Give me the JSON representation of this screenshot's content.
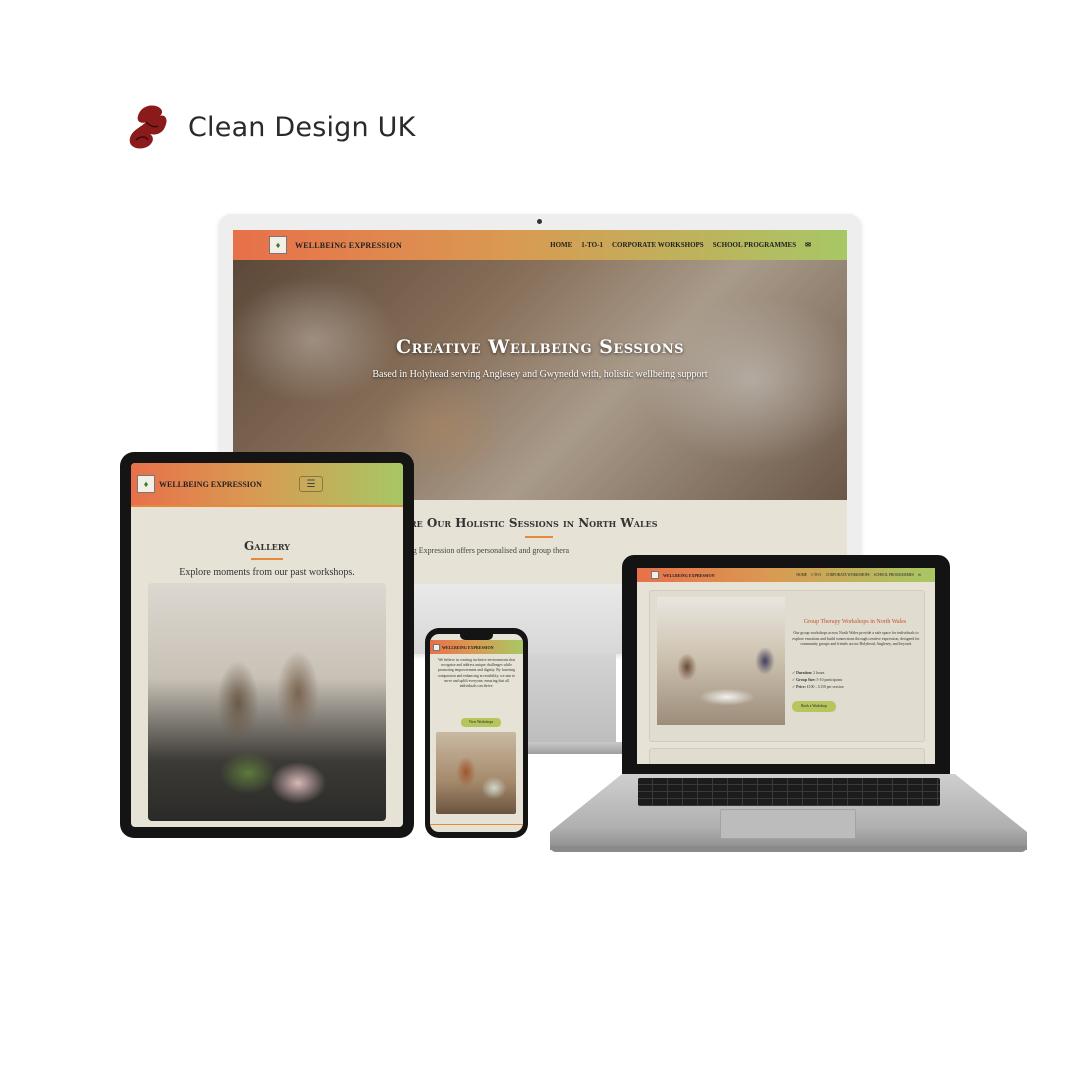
{
  "brand": {
    "name": "Clean Design UK"
  },
  "site": {
    "name": "WELLBEING EXPRESSION",
    "nav": [
      "HOME",
      "1-TO-1",
      "CORPORATE WORKSHOPS",
      "SCHOOL PROGRAMMES"
    ],
    "nav_mail_icon": "envelope-icon"
  },
  "desktop": {
    "hero_title": "Creative Wellbeing Sessions",
    "hero_subtitle": "Based in Holyhead serving Anglesey and Gwynedd with, holistic wellbeing support",
    "section_title": "ore Our Holistic Sessions in North Wales",
    "section_text": "eing Expression offers personalised and group thera"
  },
  "tablet": {
    "menu_icon": "hamburger-menu-icon",
    "gallery_title": "Gallery",
    "gallery_subtitle": "Explore moments from our past workshops."
  },
  "phone": {
    "body_text": "We believe in creating inclusive environments that recognise and address unique challenges while promoting empowerment and dignity. By fostering compassion and enhancing accessibility, we aim to serve and uplift everyone, ensuring that all individuals can thrive.",
    "button": "View Workshops"
  },
  "laptop": {
    "card_title": "Group Therapy Workshops in North Wales",
    "card_desc": "Our group workshops across North Wales provide a safe space for individuals to explore emotions and build connections through creative expression, designed for community groups and friends across Holyhead, Anglesey, and beyond.",
    "details": [
      {
        "label": "Duration:",
        "value": "2 hours"
      },
      {
        "label": "Group Size:",
        "value": "5-10 participants"
      },
      {
        "label": "Price:",
        "value": "£100 – £150 per session"
      }
    ],
    "button": "Book a Workshop"
  },
  "colors": {
    "accent_orange": "#e48a3a",
    "gradient_start": "#e8704a",
    "gradient_end": "#a8c765",
    "button_green": "#b7c65c",
    "cream": "#e6e2d5",
    "title_red": "#c0532c"
  }
}
